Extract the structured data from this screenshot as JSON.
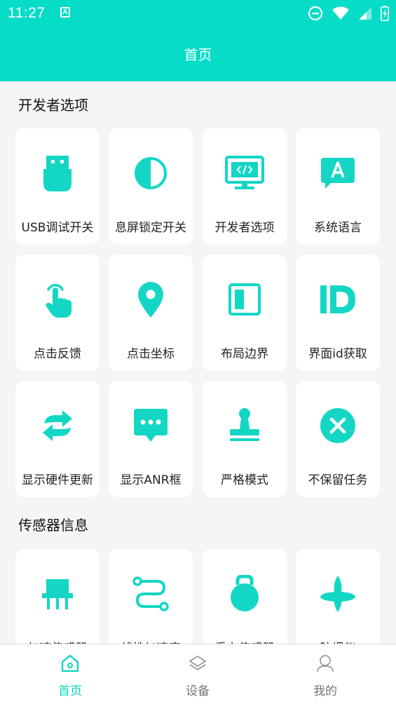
{
  "status_bar": {
    "time": "11:27",
    "app_icon_letter": "A"
  },
  "app_bar": {
    "title": "首页"
  },
  "sections": [
    {
      "title": "开发者选项",
      "items": [
        {
          "label": "USB调试开关",
          "icon": "usb-icon"
        },
        {
          "label": "息屏锁定开关",
          "icon": "half-circle-icon"
        },
        {
          "label": "开发者选项",
          "icon": "code-monitor-icon"
        },
        {
          "label": "系统语言",
          "icon": "language-icon"
        },
        {
          "label": "点击反馈",
          "icon": "tap-hand-icon"
        },
        {
          "label": "点击坐标",
          "icon": "location-pin-icon"
        },
        {
          "label": "布局边界",
          "icon": "layout-bounds-icon"
        },
        {
          "label": "界面id获取",
          "icon": "id-icon"
        },
        {
          "label": "显示硬件更新",
          "icon": "refresh-arrows-icon"
        },
        {
          "label": "显示ANR框",
          "icon": "message-dots-icon"
        },
        {
          "label": "严格模式",
          "icon": "stamp-icon"
        },
        {
          "label": "不保留任务",
          "icon": "close-circle-icon"
        }
      ]
    },
    {
      "title": "传感器信息",
      "items": [
        {
          "label": "加速传感器",
          "icon": "chip-icon"
        },
        {
          "label": "线性加速度",
          "icon": "path-icon"
        },
        {
          "label": "重力传感器",
          "icon": "kettlebell-icon"
        },
        {
          "label": "陀螺仪",
          "icon": "gyroscope-icon"
        }
      ]
    }
  ],
  "bottom_nav": [
    {
      "label": "首页",
      "icon": "home-icon",
      "active": true
    },
    {
      "label": "设备",
      "icon": "layers-icon",
      "active": false
    },
    {
      "label": "我的",
      "icon": "user-icon",
      "active": false
    }
  ],
  "colors": {
    "accent": "#07dcc7",
    "icon": "#13d7c4",
    "background": "#f5f5f5",
    "inactive": "#9a9a9a"
  }
}
